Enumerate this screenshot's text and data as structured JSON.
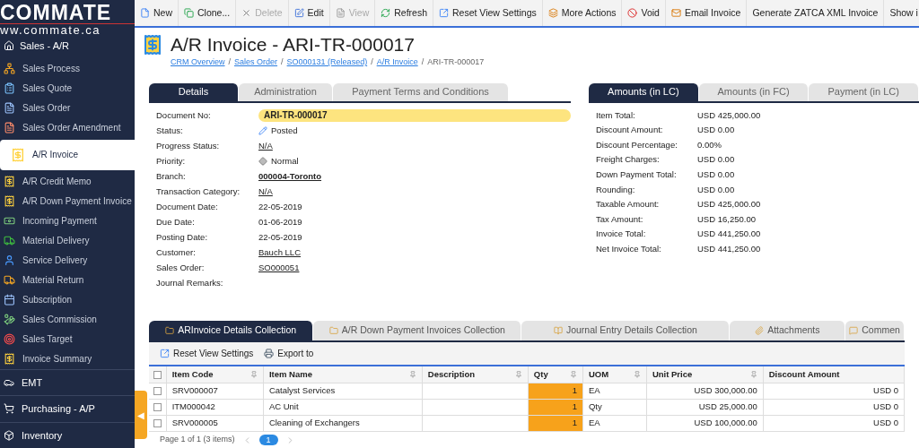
{
  "sidebar": {
    "logo": "COMMATE",
    "website": "ww.commate.ca",
    "section": "Sales - A/R",
    "items": [
      {
        "label": "Sales Process",
        "selected": false
      },
      {
        "label": "Sales Quote",
        "selected": false
      },
      {
        "label": "Sales Order",
        "selected": false
      },
      {
        "label": "Sales Order Amendment",
        "selected": false
      },
      {
        "label": "A/R Invoice",
        "selected": true
      },
      {
        "label": "A/R Credit Memo",
        "selected": false
      },
      {
        "label": "A/R Down Payment Invoice",
        "selected": false
      },
      {
        "label": "Incoming Payment",
        "selected": false
      },
      {
        "label": "Material Delivery",
        "selected": false
      },
      {
        "label": "Service Delivery",
        "selected": false
      },
      {
        "label": "Material Return",
        "selected": false
      },
      {
        "label": "Subscription",
        "selected": false
      },
      {
        "label": "Sales Commission",
        "selected": false
      },
      {
        "label": "Sales Target",
        "selected": false
      },
      {
        "label": "Invoice Summary",
        "selected": false
      }
    ],
    "groups": [
      "EMT",
      "Purchasing - A/P",
      "Inventory"
    ],
    "collapse_handle": "◀"
  },
  "toolbar": [
    {
      "label": "New",
      "disabled": false
    },
    {
      "label": "Clone...",
      "disabled": false
    },
    {
      "label": "Delete",
      "disabled": true
    },
    {
      "label": "Edit",
      "disabled": false
    },
    {
      "label": "View",
      "disabled": true
    },
    {
      "label": "Refresh",
      "disabled": false
    },
    {
      "label": "Reset View Settings",
      "disabled": false
    },
    {
      "label": "More Actions",
      "disabled": false
    },
    {
      "label": "Void",
      "disabled": false
    },
    {
      "label": "Email Invoice",
      "disabled": false
    },
    {
      "label": "Generate ZATCA XML Invoice",
      "disabled": false
    },
    {
      "label": "Show i",
      "disabled": false
    }
  ],
  "title": "A/R Invoice - ARI-TR-000017",
  "breadcrumb": [
    {
      "label": "CRM Overview",
      "kind": "link"
    },
    {
      "label": "/",
      "kind": "separator"
    },
    {
      "label": "Sales Order",
      "kind": "link"
    },
    {
      "label": "/",
      "kind": "separator"
    },
    {
      "label": "SO000131 (Released)",
      "kind": "link"
    },
    {
      "label": "/",
      "kind": "separator"
    },
    {
      "label": "A/R Invoice",
      "kind": "link"
    },
    {
      "label": "/",
      "kind": "separator"
    },
    {
      "label": "ARI-TR-000017",
      "kind": "current"
    }
  ],
  "details_tabs": [
    {
      "label": "Details",
      "selected": true
    },
    {
      "label": "Administration",
      "selected": false
    },
    {
      "label": "Payment Terms and Conditions",
      "selected": false
    }
  ],
  "details": [
    {
      "label": "Document No:",
      "value": "ARI-TR-000017",
      "kind": "highlight"
    },
    {
      "label": "Status:",
      "value": "Posted",
      "kind": "status"
    },
    {
      "label": "Progress Status:",
      "value": "N/A",
      "kind": "link"
    },
    {
      "label": "Priority:",
      "value": "Normal",
      "kind": "priority"
    },
    {
      "label": "Branch:",
      "value": "000004-Toronto",
      "kind": "bold-link"
    },
    {
      "label": "Transaction Category:",
      "value": "N/A",
      "kind": "link"
    },
    {
      "label": "Document Date:",
      "value": "22-05-2019",
      "kind": "plain"
    },
    {
      "label": "Due Date:",
      "value": "01-06-2019",
      "kind": "plain"
    },
    {
      "label": "Posting Date:",
      "value": "22-05-2019",
      "kind": "plain"
    },
    {
      "label": "Customer:",
      "value": "Bauch LLC",
      "kind": "link"
    },
    {
      "label": "Sales Order:",
      "value": "SO000051",
      "kind": "link"
    },
    {
      "label": "Journal Remarks:"
    }
  ],
  "amounts_tabs": [
    {
      "label": "Amounts (in LC)",
      "selected": true
    },
    {
      "label": "Amounts (in FC)",
      "selected": false
    },
    {
      "label": "Payment (in LC)",
      "selected": false
    }
  ],
  "amounts": [
    {
      "label": "Item Total:",
      "value": "USD 425,000.00"
    },
    {
      "label": "Discount Amount:",
      "value": "USD 0.00"
    },
    {
      "label": "Discount Percentage:",
      "value": "0.00%"
    },
    {
      "label": "Freight Charges:",
      "value": "USD 0.00"
    },
    {
      "label": "Down Payment Total:",
      "value": "USD 0.00"
    },
    {
      "label": "Rounding:",
      "value": "USD 0.00"
    },
    {
      "label": "Taxable Amount:",
      "value": "USD 425,000.00"
    },
    {
      "label": "Tax Amount:",
      "value": "USD 16,250.00"
    },
    {
      "label": "Invoice Total:",
      "value": "USD 441,250.00"
    },
    {
      "label": "Net Invoice Total:",
      "value": "USD 441,250.00"
    }
  ],
  "collection_tabs": [
    {
      "label": "ARInvoice Details Collection",
      "selected": true
    },
    {
      "label": "A/R Down Payment Invoices Collection",
      "selected": false
    },
    {
      "label": "Journal Entry Details Collection",
      "selected": false
    },
    {
      "label": "Attachments",
      "selected": false
    },
    {
      "label": "Commen",
      "selected": false
    }
  ],
  "grid_toolbar": [
    "Reset View Settings",
    "Export to"
  ],
  "table": {
    "all_checked": false,
    "columns": [
      {
        "label": "Item Code",
        "highlighted": false,
        "kind": "text"
      },
      {
        "label": "Item Name",
        "highlighted": false,
        "kind": "text"
      },
      {
        "label": "Description",
        "highlighted": false,
        "kind": "text"
      },
      {
        "label": "Qty",
        "highlighted": true,
        "kind": "number"
      },
      {
        "label": "UOM",
        "highlighted": false,
        "kind": "text"
      },
      {
        "label": "Unit Price",
        "highlighted": false,
        "kind": "number"
      },
      {
        "label": "Discount Amount",
        "highlighted": false,
        "kind": "number"
      }
    ],
    "rows": [
      {
        "checked": false,
        "cells": [
          "SRV000007",
          "Catalyst Services",
          "",
          "1",
          "EA",
          "USD 300,000.00",
          "USD 0"
        ]
      },
      {
        "checked": false,
        "cells": [
          "ITM000042",
          "AC Unit",
          "",
          "1",
          "Qty",
          "USD 25,000.00",
          "USD 0"
        ]
      },
      {
        "checked": false,
        "cells": [
          "SRV000005",
          "Cleaning of Exchangers",
          "",
          "1",
          "EA",
          "USD 100,000.00",
          "USD 0"
        ]
      }
    ]
  },
  "pager": {
    "summary": "Page 1 of 1 (3 items)",
    "pages": [
      {
        "label": "1",
        "selected": true
      }
    ]
  }
}
